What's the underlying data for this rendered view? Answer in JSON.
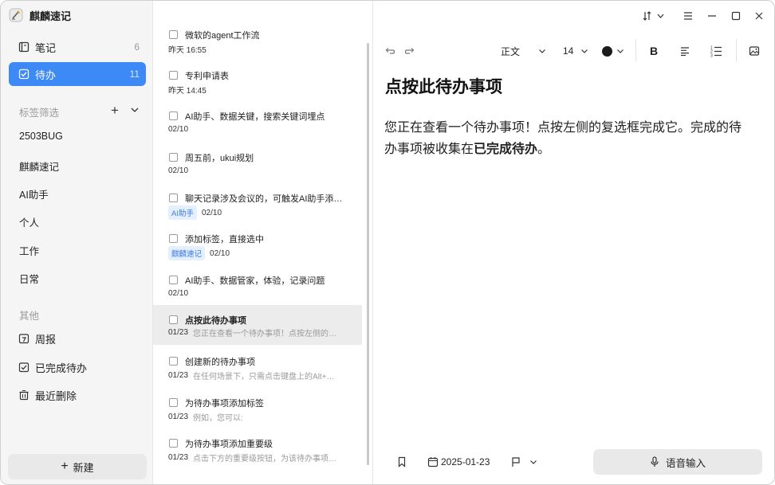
{
  "app": {
    "title": "麒麟速记"
  },
  "sidebar": {
    "items": [
      {
        "label": "笔记",
        "count": "6"
      },
      {
        "label": "待办",
        "count": "11"
      }
    ],
    "tags_section_title": "标签筛选",
    "tags": [
      "2503BUG",
      "麒麟速记",
      "AI助手",
      "个人",
      "工作",
      "日常"
    ],
    "other_section_title": "其他",
    "other_items": [
      "周报",
      "已完成待办",
      "最近删除"
    ],
    "new_button_label": "新建"
  },
  "notes": [
    {
      "title": "微软的agent工作流",
      "date": "昨天 16:55",
      "tag": "",
      "preview": ""
    },
    {
      "title": "专利申请表",
      "date": "昨天 14:45",
      "tag": "",
      "preview": ""
    },
    {
      "title": "AI助手、数据关键，搜索关键词埋点",
      "date": "02/10",
      "tag": "",
      "preview": ""
    },
    {
      "title": "周五前，ukui规划",
      "date": "02/10",
      "tag": "",
      "preview": ""
    },
    {
      "title": "聊天记录涉及会议的，可触发AI助手添…",
      "date": "02/10",
      "tag": "AI助手",
      "preview": ""
    },
    {
      "title": "添加标签，直接选中",
      "date": "02/10",
      "tag": "麒麟速记",
      "preview": ""
    },
    {
      "title": "AI助手、数据管家，体验，记录问题",
      "date": "02/10",
      "tag": "",
      "preview": ""
    },
    {
      "title": "点按此待办事项",
      "date": "01/23",
      "tag": "",
      "preview": "您正在查看一个待办事项！点按左侧的…"
    },
    {
      "title": "创建新的待办事项",
      "date": "01/23",
      "tag": "",
      "preview": "在任何场景下，只需点击键盘上的Alt+…"
    },
    {
      "title": "为待办事项添加标签",
      "date": "01/23",
      "tag": "",
      "preview": "例如，您可以:"
    },
    {
      "title": "为待办事项添加重要级",
      "date": "01/23",
      "tag": "",
      "preview": "点击下方的重要级按钮，为该待办事项…"
    }
  ],
  "toolbar": {
    "style": "正文",
    "font_size": "14",
    "bold": "B"
  },
  "editor": {
    "title": "点按此待办事项",
    "body_line1": "您正在查看一个待办事项！点按左侧的复选框完成它。完成的待",
    "body_line2_prefix": "办事项被收集在",
    "body_line2_bold": "已完成待办",
    "body_line2_suffix": "。"
  },
  "footer": {
    "date": "2025-01-23",
    "voice_label": "语音输入"
  },
  "colors": {
    "accent": "#3d8af7",
    "text_color": "#1b1b1b"
  }
}
